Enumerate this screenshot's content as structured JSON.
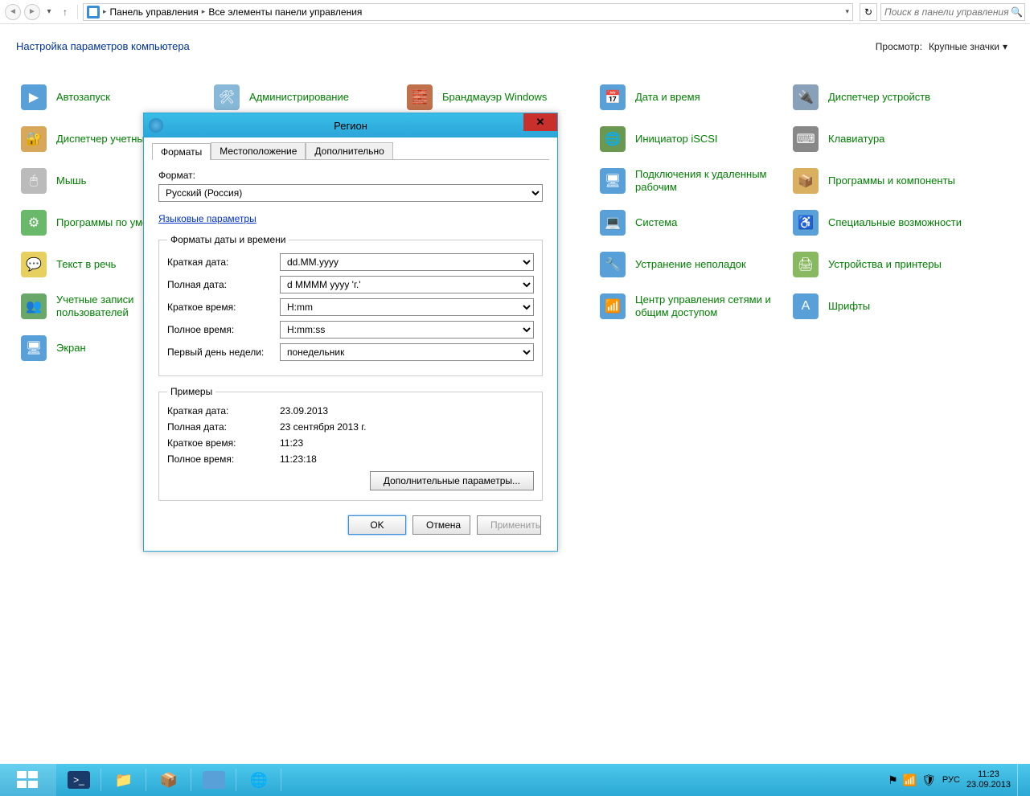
{
  "addressbar": {
    "seg1": "Панель управления",
    "seg2": "Все элементы панели управления",
    "search_placeholder": "Поиск в панели управления"
  },
  "header": {
    "title": "Настройка параметров компьютера",
    "view_label": "Просмотр:",
    "view_value": "Крупные значки"
  },
  "items": {
    "c1": [
      {
        "label": "Автозапуск"
      },
      {
        "label": "Диспетчер учетных данных"
      },
      {
        "label": "Мышь"
      },
      {
        "label": "Программы по умолчанию"
      },
      {
        "label": "Текст в речь"
      },
      {
        "label": "Учетные записи пользователей"
      },
      {
        "label": "Экран"
      }
    ],
    "c2": [
      {
        "label": "Администрирование"
      },
      {
        "label": "Брандмауэр Windows"
      }
    ],
    "c3": [
      {
        "label": "Дата и время"
      },
      {
        "label": "Инициатор iSCSI"
      },
      {
        "label": "Подключения к удаленным рабочим"
      },
      {
        "label": "Система"
      },
      {
        "label": "Устранение неполадок"
      },
      {
        "label": "Центр управления сетями и общим доступом"
      }
    ],
    "c4": [
      {
        "label": "Диспетчер устройств"
      },
      {
        "label": "Клавиатура"
      },
      {
        "label": "Программы и компоненты"
      },
      {
        "label": "Специальные возможности"
      },
      {
        "label": "Устройства и принтеры"
      },
      {
        "label": "Шрифты"
      }
    ]
  },
  "dialog": {
    "title": "Регион",
    "tabs": {
      "formats": "Форматы",
      "location": "Местоположение",
      "additional": "Дополнительно"
    },
    "format_label": "Формат:",
    "format_value": "Русский (Россия)",
    "lang_link": "Языковые параметры",
    "date_formats_legend": "Форматы даты и времени",
    "rows": {
      "short_date": {
        "label": "Краткая дата:",
        "value": "dd.MM.yyyy"
      },
      "long_date": {
        "label": "Полная дата:",
        "value": "d MMMM yyyy 'г.'"
      },
      "short_time": {
        "label": "Краткое время:",
        "value": "H:mm"
      },
      "long_time": {
        "label": "Полное время:",
        "value": "H:mm:ss"
      },
      "first_day": {
        "label": "Первый день недели:",
        "value": "понедельник"
      }
    },
    "examples_legend": "Примеры",
    "examples": {
      "short_date": {
        "label": "Краткая дата:",
        "value": "23.09.2013"
      },
      "long_date": {
        "label": "Полная дата:",
        "value": "23 сентября 2013 г."
      },
      "short_time": {
        "label": "Краткое время:",
        "value": "11:23"
      },
      "long_time": {
        "label": "Полное время:",
        "value": "11:23:18"
      }
    },
    "advanced_btn": "Дополнительные параметры...",
    "ok": "OK",
    "cancel": "Отмена",
    "apply": "Применить"
  },
  "taskbar": {
    "lang": "РУС",
    "time": "11:23",
    "date": "23.09.2013"
  }
}
